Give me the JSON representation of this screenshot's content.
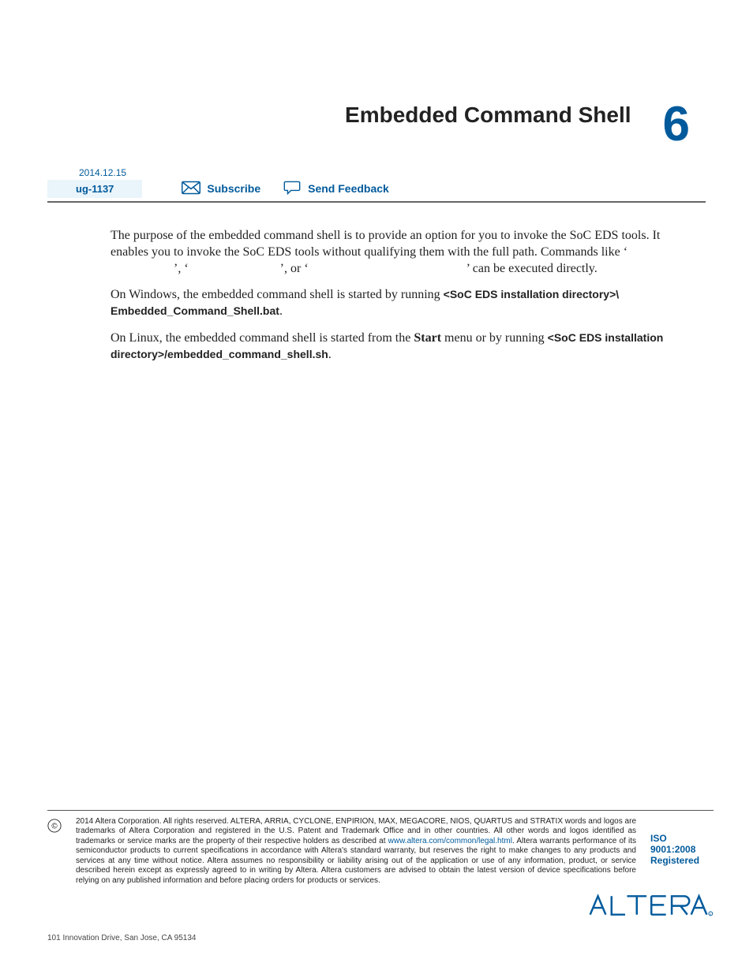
{
  "header": {
    "title": "Embedded Command Shell",
    "chapter_number": "6",
    "date": "2014.12.15",
    "doc_id": "ug-1137",
    "subscribe_label": "Subscribe",
    "feedback_label": "Send Feedback"
  },
  "body": {
    "p1_a": "The purpose of the embedded command shell is to provide an option for you to invoke the SoC EDS tools. It enables you to invoke the SoC EDS tools without qualifying them with the full path. Commands like ‘",
    "p1_b": "’, ‘",
    "p1_c": "’, or ‘",
    "p1_d": "’ can be executed directly.",
    "p2_a": "On Windows, the embedded command shell is started by running ",
    "p2_b": "<SoC EDS installation directory>\\ Embedded_Command_Shell.bat",
    "p2_c": ".",
    "p3_a": "On Linux, the embedded command shell is started from the ",
    "p3_start": "Start",
    "p3_b": " menu or by running ",
    "p3_c": "<SoC EDS installa­tion directory>/embedded_command_shell.sh",
    "p3_d": "."
  },
  "footer": {
    "copyright_a": "2014 Altera Corporation. All rights reserved. ALTERA, ARRIA, CYCLONE, ENPIRION, MAX, MEGACORE, NIOS, QUARTUS and STRATIX words and logos are trademarks of Altera Corporation and registered in the U.S. Patent and Trademark Office and in other countries. All other words and logos identified as trademarks or service marks are the property of their respective holders as described at ",
    "legal_link": "www.altera.com/common/legal.html",
    "copyright_b": ". Altera warrants performance of its semiconductor products to current specifications in accordance with Altera's standard warranty, but reserves the right to make changes to any products and services at any time without notice. Altera assumes no responsibility or liability arising out of the application or use of any information, product, or service described herein except as expressly agreed to in writing by Altera. Altera customers are advised to obtain the latest version of device specifications before relying on any published information and before placing orders for products or services.",
    "iso_line1": "ISO",
    "iso_line2": "9001:2008",
    "iso_line3": "Registered",
    "address": "101 Innovation Drive, San Jose, CA 95134",
    "logo_text": "ALTERA"
  }
}
